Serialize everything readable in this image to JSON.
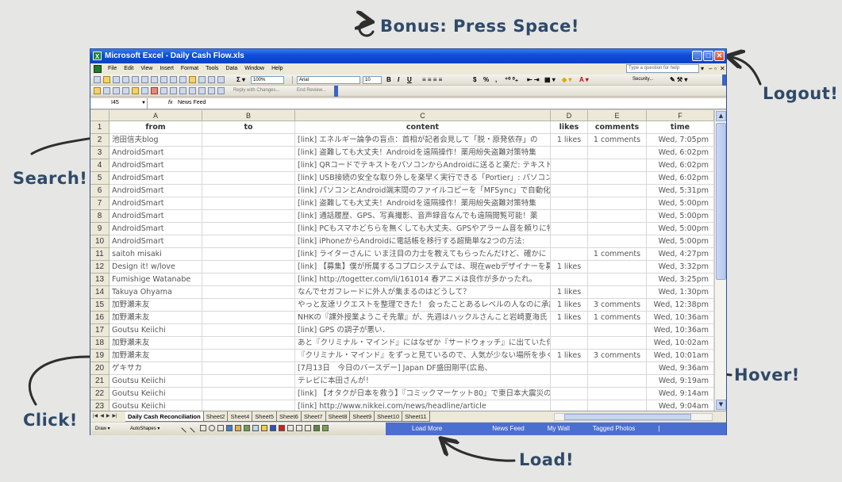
{
  "callouts": {
    "bonus": "Bonus:  Press Space!",
    "logout": "Logout!",
    "search": "Search!",
    "hover": "Hover!",
    "click": "Click!",
    "load": "Load!"
  },
  "window": {
    "title": "Microsoft Excel - Daily Cash Flow.xls",
    "menus": [
      "File",
      "Edit",
      "View",
      "Insert",
      "Format",
      "Tools",
      "Data",
      "Window",
      "Help"
    ],
    "help_placeholder": "Type a question for help",
    "zoom": "100%",
    "font": "Arial",
    "font_size": "10",
    "security": "Security...",
    "reply_with_changes": "Reply with Changes...",
    "end_review": "End Review..."
  },
  "formula_bar": {
    "name_box": "I45",
    "fx": "fx",
    "value": "News Feed"
  },
  "columns": [
    "A",
    "B",
    "C",
    "D",
    "E",
    "F"
  ],
  "header_row": {
    "num": "1",
    "from": "from",
    "to": "to",
    "content": "content",
    "likes": "likes",
    "comments": "comments",
    "time": "time"
  },
  "rows": [
    {
      "num": "2",
      "from": "池田信夫blog",
      "to": "",
      "content": "[link] エネルギー論争の盲点：首相が記者会見して「脱・原発依存」の",
      "likes": "1 likes",
      "comments": "1 comments",
      "time": "Wed,  7:05pm"
    },
    {
      "num": "3",
      "from": "AndroidSmart",
      "to": "",
      "content": "[link] 盗難しても大丈夫！Androidを遠隔操作！薬用紛失盗難対策特集",
      "likes": "",
      "comments": "",
      "time": "Wed,  6:02pm"
    },
    {
      "num": "4",
      "from": "AndroidSmart",
      "to": "",
      "content": "[link] QRコードでテキストをパソコンからAndroidに送ると楽だ: テキスト",
      "likes": "",
      "comments": "",
      "time": "Wed,  6:02pm"
    },
    {
      "num": "5",
      "from": "AndroidSmart",
      "to": "",
      "content": "[link] USB接続の安全な取り外しを楽早く実行できる「Portier」: パソコン",
      "likes": "",
      "comments": "",
      "time": "Wed,  6:02pm"
    },
    {
      "num": "6",
      "from": "AndroidSmart",
      "to": "",
      "content": "[link] パソコンとAndroid端末間のファイルコピーを「MFSync」で自動化:",
      "likes": "",
      "comments": "",
      "time": "Wed,  5:31pm"
    },
    {
      "num": "7",
      "from": "AndroidSmart",
      "to": "",
      "content": "[link] 盗難しても大丈夫！Androidを遠隔操作！薬用紛失盗難対策特集",
      "likes": "",
      "comments": "",
      "time": "Wed,  5:00pm"
    },
    {
      "num": "8",
      "from": "AndroidSmart",
      "to": "",
      "content": "[link] 通話履歴、GPS、写真撮影、音声録音なんでも遠隔閲覧可能！薬",
      "likes": "",
      "comments": "",
      "time": "Wed,  5:00pm"
    },
    {
      "num": "9",
      "from": "AndroidSmart",
      "to": "",
      "content": "[link] PCもスマホどちらを無くしても大丈夫、GPSやアラーム音を頼りに特",
      "likes": "",
      "comments": "",
      "time": "Wed,  5:00pm"
    },
    {
      "num": "10",
      "from": "AndroidSmart",
      "to": "",
      "content": "[link] iPhoneからAndroidに電話帳を移行する超簡単な2つの方法:",
      "likes": "",
      "comments": "",
      "time": "Wed,  5:00pm"
    },
    {
      "num": "11",
      "from": "saitoh misaki",
      "to": "",
      "content": "[link] ライターさんに いま注目の力士を教えてもらったんだけど、確かに",
      "likes": "",
      "comments": "1 comments",
      "time": "Wed,  4:27pm"
    },
    {
      "num": "12",
      "from": "Design it! w/love",
      "to": "",
      "content": "[link] 【募集】僕が所属するコプロシステムでは、現在webデザイナーを募",
      "likes": "1 likes",
      "comments": "",
      "time": "Wed,  3:32pm"
    },
    {
      "num": "13",
      "from": "Fumishige Watanabe",
      "to": "",
      "content": "[link] http://togetter.com/li/161014 春アニメは良作が多かったれ。",
      "likes": "",
      "comments": "",
      "time": "Wed,  3:25pm"
    },
    {
      "num": "14",
      "from": "Takuya Ohyama",
      "to": "",
      "content": "なんでセガフレードに外人が集まるのはどうして？",
      "likes": "1 likes",
      "comments": "",
      "time": "Wed,  1:30pm"
    },
    {
      "num": "15",
      "from": "加野瀬未友",
      "to": "",
      "content": "やっと友達リクエストを整理できた！ 会ったことあるレベルの人なのに承認",
      "likes": "1 likes",
      "comments": "3 comments",
      "time": "Wed, 12:38pm"
    },
    {
      "num": "16",
      "from": "加野瀬未友",
      "to": "",
      "content": "NHKの『課外授業ようこそ先輩』が、先週はハックルさんこと岩崎夏海氏",
      "likes": "1 likes",
      "comments": "1 comments",
      "time": "Wed, 10:36am"
    },
    {
      "num": "17",
      "from": "Goutsu Keiichi",
      "to": "",
      "content": "[link] GPS の調子が悪い．",
      "likes": "",
      "comments": "",
      "time": "Wed, 10:36am"
    },
    {
      "num": "18",
      "from": "加野瀬未友",
      "to": "",
      "content": "あと『クリミナル・マインド』にはなぜか『サードウォッチ』に出ていた俳優がゲ",
      "likes": "",
      "comments": "",
      "time": "Wed, 10:02am"
    },
    {
      "num": "19",
      "from": "加野瀬未友",
      "to": "",
      "content": "『クリミナル・マインド』をずっと見ているので、人気が少ない場所を歩くと、こ",
      "likes": "1 likes",
      "comments": "3 comments",
      "time": "Wed, 10:01am"
    },
    {
      "num": "20",
      "from": "ゲキサカ",
      "to": "",
      "content": "[7月13日　今日のバースデー] Japan DF盛田剛平(広島、",
      "likes": "",
      "comments": "",
      "time": "Wed,  9:36am"
    },
    {
      "num": "21",
      "from": "Goutsu Keiichi",
      "to": "",
      "content": "テレビに本田さんが！",
      "likes": "",
      "comments": "",
      "time": "Wed,  9:19am"
    },
    {
      "num": "22",
      "from": "Goutsu Keiichi",
      "to": "",
      "content": "[link] 【オタクが日本を救う】『コミックマーケット80』で東日本大震災の義",
      "likes": "",
      "comments": "",
      "time": "Wed,  9:14am"
    },
    {
      "num": "23",
      "from": "Goutsu Keiichi",
      "to": "",
      "content": "[link] http://www.nikkei.com/news/headline/article",
      "likes": "",
      "comments": "",
      "time": "Wed,  9:04am"
    }
  ],
  "sheet_tabs": [
    "Daily Cash Reconciliation",
    "Sheet2",
    "Sheet4",
    "Sheet5",
    "Sheet6",
    "Sheet7",
    "Sheet8",
    "Sheet9",
    "Sheet10",
    "Sheet11"
  ],
  "drawbar": {
    "draw": "Draw ▾",
    "autoshapes": "AutoShapes ▾"
  },
  "fb_nav": [
    "Load More",
    "News Feed",
    "My Wall",
    "Tagged Photos",
    "|"
  ]
}
